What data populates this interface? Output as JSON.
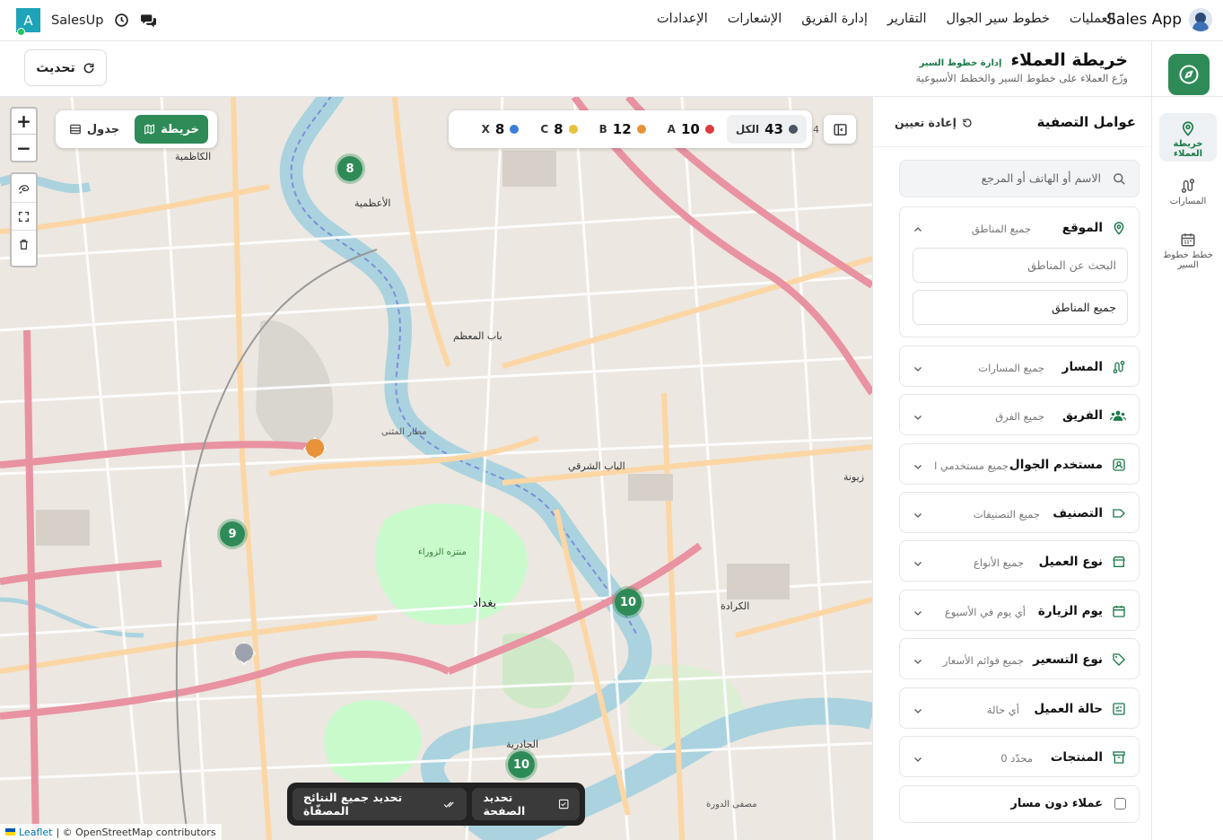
{
  "app": {
    "brand": "Sales App",
    "user_initial": "A",
    "company": "SalesUp"
  },
  "nav": [
    {
      "label": "العمليات"
    },
    {
      "label": "خطوط سير الجوال"
    },
    {
      "label": "التقارير"
    },
    {
      "label": "إدارة الفريق"
    },
    {
      "label": "الإشعارات"
    },
    {
      "label": "الإعدادات"
    }
  ],
  "page": {
    "title": "خريطة العملاء",
    "breadcrumb": "إدارة خطوط السير",
    "subtitle": "وزّع العملاء على خطوط السير والخطط الأسبوعية",
    "refresh_label": "تحديث"
  },
  "rail": [
    {
      "label": "خريطة العملاء",
      "icon": "map-pin-icon"
    },
    {
      "label": "المسارات",
      "icon": "route-icon"
    },
    {
      "label": "خطط خطوط السير",
      "icon": "calendar-icon"
    }
  ],
  "filters": {
    "title": "عوامل التصفية",
    "reset_label": "إعادة تعيين",
    "search_placeholder": "الاسم أو الهاتف أو المرجع",
    "location": {
      "label": "الموقع",
      "value": "جميع المناطق",
      "search_placeholder": "البحث عن المناطق",
      "selected": "جميع المناطق"
    },
    "items": [
      {
        "label": "المسار",
        "value": "جميع المسارات",
        "icon": "route-icon"
      },
      {
        "label": "الفريق",
        "value": "جميع الفرق",
        "icon": "team-icon"
      },
      {
        "label": "مستخدم الجوال",
        "value": "جميع مستخدمي ا...",
        "icon": "user-badge-icon"
      },
      {
        "label": "التصنيف",
        "value": "جميع التصنيفات",
        "icon": "tag-outline-icon"
      },
      {
        "label": "نوع العميل",
        "value": "جميع الأنواع",
        "icon": "store-icon"
      },
      {
        "label": "يوم الزيارة",
        "value": "أي يوم في الأسبوع",
        "icon": "calendar-icon"
      },
      {
        "label": "نوع التسعير",
        "value": "جميع قوائم الأسعار",
        "icon": "price-tag-icon"
      },
      {
        "label": "حالة العميل",
        "value": "أي حالة",
        "icon": "status-icon"
      },
      {
        "label": "المنتجات",
        "value": "0 محدّد",
        "icon": "archive-icon"
      }
    ],
    "no_route_label": "عملاء دون مسار"
  },
  "map": {
    "view_map": "خريطة",
    "view_table": "جدول",
    "legend": [
      {
        "key": "all",
        "name": "الكل",
        "count": "43",
        "color": "#4b5563"
      },
      {
        "key": "a",
        "name": "A",
        "count": "10",
        "color": "#dc3c3c"
      },
      {
        "key": "b",
        "name": "B",
        "count": "12",
        "color": "#e8923a"
      },
      {
        "key": "c",
        "name": "C",
        "count": "8",
        "color": "#e7c13b"
      },
      {
        "key": "x",
        "name": "X",
        "count": "8",
        "color": "#3b7dd8"
      }
    ],
    "edge_count": "4",
    "clusters": [
      "8",
      "9",
      "10",
      "10"
    ],
    "labels": [
      "الكاظمية",
      "الأعظمية",
      "باب المعظم",
      "الباب الشرقي",
      "بغداد",
      "الكرادة",
      "الجادرية",
      "زيونة",
      "مصفى الدورة",
      "مطار المثنى",
      "منتزه الزوراء"
    ],
    "zoom_in": "+",
    "zoom_out": "−",
    "action_select_page": "تحديد الصفحة",
    "action_select_all": "تحديد جميع النتائج المصفّاة",
    "attribution_leaflet": "Leaflet",
    "attribution_osm": "| © OpenStreetMap contributors",
    "colors": {
      "accent": "#2e8b57",
      "water": "#aad3df",
      "park": "#c8facc",
      "major_road": "#e892a2",
      "road": "#fcd6a4"
    }
  }
}
